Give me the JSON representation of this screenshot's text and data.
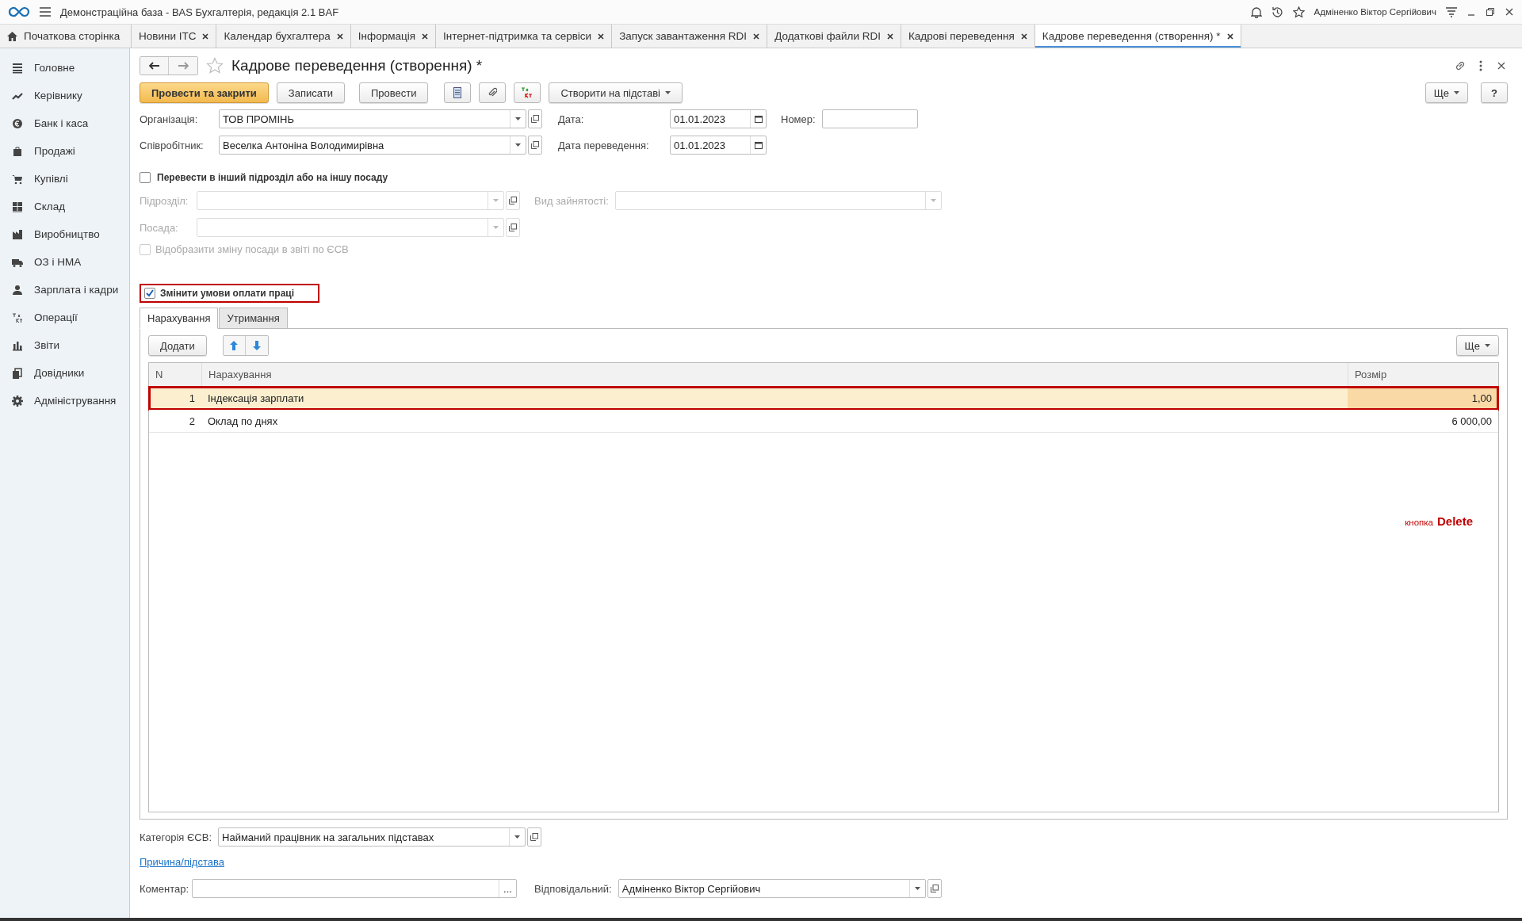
{
  "window": {
    "title": "Демонстраційна база - BAS Бухгалтерія, редакція 2.1 BAF",
    "user": "Адміненко Віктор Сергійович"
  },
  "open_tabs": [
    {
      "label": "Початкова сторінка",
      "kind": "home",
      "selected": false
    },
    {
      "label": "Новини ІТС",
      "kind": "closable",
      "selected": false
    },
    {
      "label": "Календар бухгалтера",
      "kind": "closable",
      "selected": false
    },
    {
      "label": "Інформація",
      "kind": "closable",
      "selected": false
    },
    {
      "label": "Інтернет-підтримка та сервіси",
      "kind": "closable",
      "selected": false
    },
    {
      "label": "Запуск завантаження RDI",
      "kind": "closable",
      "selected": false
    },
    {
      "label": "Додаткові файли RDI",
      "kind": "closable",
      "selected": false
    },
    {
      "label": "Кадрові переведення",
      "kind": "closable",
      "selected": false
    },
    {
      "label": "Кадрове переведення (створення) *",
      "kind": "closable",
      "selected": true
    }
  ],
  "sidebar": {
    "items": [
      "Головне",
      "Керівнику",
      "Банк і каса",
      "Продажі",
      "Купівлі",
      "Склад",
      "Виробництво",
      "ОЗ і НМА",
      "Зарплата і кадри",
      "Операції",
      "Звіти",
      "Довідники",
      "Адміністрування"
    ]
  },
  "form": {
    "title": "Кадрове переведення (створення) *",
    "toolbar": {
      "primary": "Провести та закрити",
      "buttons": [
        "Записати",
        "Провести"
      ],
      "create_based": "Створити на підставі",
      "more": "Ще",
      "help": "?"
    },
    "fields": [
      {
        "label": "Організація:",
        "value": "ТОВ ПРОМІНЬ"
      },
      {
        "label": "Співробітник:",
        "value": "Веселка Антоніна Володимирівна"
      }
    ],
    "dates": [
      {
        "label": "Дата:",
        "value": "01.01.2023"
      },
      {
        "label": "Дата переведення:",
        "value": "01.01.2023"
      }
    ],
    "number": {
      "label": "Номер:"
    },
    "transfer": {
      "label": "Перевести в інший підрозділ або на іншу посаду",
      "checked": false
    },
    "transfer_fields": [
      {
        "label": "Підрозділ:",
        "disabled": true
      },
      {
        "label": "Посада:",
        "disabled": true
      }
    ],
    "employment": {
      "label": "Вид зайнятості:",
      "disabled": true
    },
    "show_change": {
      "label": "Відобразити зміну посади в звіті по ЄСВ",
      "checked": false,
      "disabled": true
    },
    "change_pay": {
      "label": "Змінити умови оплати праці",
      "checked": true,
      "highlighted": true
    },
    "tabs": [
      {
        "label": "Нарахування",
        "selected": true
      },
      {
        "label": "Утримання",
        "selected": false
      }
    ],
    "table_toolbar": {
      "add": "Додати",
      "more": "Ще"
    },
    "table": {
      "columns": [
        "N",
        "Нарахування",
        "Розмір"
      ],
      "rows": [
        {
          "n": "1",
          "name": "Індексація зарплати",
          "amount": "1,00",
          "selected": true,
          "highlighted": true
        },
        {
          "n": "2",
          "name": "Оклад по днях",
          "amount": "6 000,00",
          "selected": false,
          "highlighted": false
        }
      ]
    },
    "annotation": {
      "prefix": "кнопка",
      "key": "Delete"
    },
    "category": {
      "label": "Категорія ЄСВ:",
      "value": "Найманий працівник на загальних підставах"
    },
    "reason_link": "Причина/підстава",
    "comment": {
      "label": "Коментар:",
      "button": "..."
    },
    "responsible": {
      "label": "Відповідальний:",
      "value": "Адміненко Віктор Сергійович"
    }
  }
}
